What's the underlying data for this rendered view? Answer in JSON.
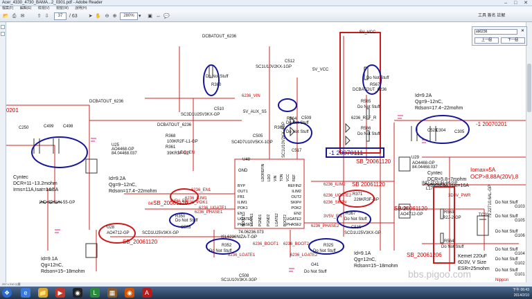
{
  "window": {
    "title": "Acer_4330_4730_BAMA...2_0301.pdf - Adobe Reader",
    "controls": "– □ ✕"
  },
  "menu": [
    "檔案(F)",
    "編輯(E)",
    "檢視(V)",
    "視窗(W)",
    "說明(H)"
  ],
  "toolbar": {
    "page_current": "37",
    "page_total": "/ 63",
    "zoom": "280%",
    "zoom_arrow": "▾",
    "page_label": "工具 簽名 註解"
  },
  "find": {
    "label": "搜尋",
    "value": "sb6236",
    "prev": "上一個",
    "next": "下一個",
    "close": "✕"
  },
  "status": {
    "text": "297 x 210 公厘"
  },
  "tray": {
    "time": "下午 06:43",
    "date": "2014/2/10"
  },
  "watermark": "bbs.pigoo.com",
  "colors": {
    "annot_red": "#cc1b1b",
    "annot_blue": "#16169a",
    "wire": "#cc2020",
    "pink": "#e0207a",
    "net": "#cc0000"
  },
  "schematic": {
    "chip": {
      "ref": "U48",
      "part": "74.06236.073",
      "name": "ISL6236NIZA-T-GP",
      "gnd": "GND"
    },
    "chip_pins_left": [
      "BYP",
      "OUT1",
      "FB1",
      "ILIM1",
      "POK1",
      "EN1",
      "UGATE1",
      "PHASE1"
    ],
    "chip_pins_right": [
      "REFIN2",
      "ILIM2",
      "OUT2",
      "SKIP#",
      "POK2",
      "EN2",
      "UGATE2",
      "PHASE2"
    ],
    "chip_pins_top": [
      "LDOREFIN",
      "LDO",
      "VIN",
      "TON",
      "VCC",
      "REF"
    ],
    "chip_pins_bottom": [
      "BOOT1",
      "LGATE1",
      "PGND1",
      "PGND2",
      "LGATE2",
      "BOOT2"
    ],
    "labels": [
      {
        "id": "dcbat1",
        "t": "DCBATOUT_6236"
      },
      {
        "id": "dcbat2",
        "t": "DCBATOUT_6236"
      },
      {
        "id": "dcbat3",
        "t": "DCBATOUT_6236"
      },
      {
        "id": "dcbat4",
        "t": "DCBATOUT_6236"
      },
      {
        "id": "r360",
        "t": "R360"
      },
      {
        "id": "dns1",
        "t": "Do Not Stuff"
      },
      {
        "id": "vin",
        "t": "6236_VIN"
      },
      {
        "id": "c512",
        "t": "C512"
      },
      {
        "id": "c512v",
        "t": "SC1U10V2KX-1GP"
      },
      {
        "id": "fivevcc1",
        "t": "5V_VCC"
      },
      {
        "id": "fivevcc2",
        "t": "5V_VCC"
      },
      {
        "id": "r567",
        "t": "R567"
      },
      {
        "id": "dns2",
        "t": "Do Not Stuff"
      },
      {
        "id": "r565",
        "t": "R565"
      },
      {
        "id": "dns3",
        "t": "Do Not Stuff"
      },
      {
        "id": "refr",
        "t": "6236_REF_R"
      },
      {
        "id": "r566",
        "t": "R566"
      },
      {
        "id": "dns4",
        "t": "Do Not Stuff"
      },
      {
        "id": "c510",
        "t": "C510"
      },
      {
        "id": "c510v",
        "t": "SC3D1U25V3KX-GP"
      },
      {
        "id": "auxs5",
        "t": "5V_AUX_S5"
      },
      {
        "id": "r364",
        "t": "R364"
      },
      {
        "id": "dns5",
        "t": "Do Not Stuff"
      },
      {
        "id": "r369",
        "t": "R369"
      },
      {
        "id": "dns6",
        "t": "Do Not Stuff"
      },
      {
        "id": "c509",
        "t": "C509"
      },
      {
        "id": "c505",
        "t": "C505"
      },
      {
        "id": "c505v",
        "t": "SC4D7U10V5KX-1GP"
      },
      {
        "id": "c517",
        "t": "C517"
      },
      {
        "id": "c517v",
        "t": "SC1U10V2KX-4GP"
      },
      {
        "id": "r368",
        "t": "R368"
      },
      {
        "id": "r368v",
        "t": "100KR2F-L1-GP"
      },
      {
        "id": "r361",
        "t": "R361"
      },
      {
        "id": "r361v",
        "t": "39KR3F-GP"
      },
      {
        "id": "ldoen",
        "t": "LDO_EN"
      },
      {
        "id": "u48",
        "t": "U48"
      },
      {
        "id": "sb1",
        "t": "SB_20061120"
      },
      {
        "id": "sb2",
        "t": "SB_20061120"
      },
      {
        "id": "sb3",
        "t": "SB_20061120"
      },
      {
        "id": "sb4",
        "t": "SB 20061120"
      },
      {
        "id": "sb5",
        "t": "SB_20061206"
      },
      {
        "id": "sb6",
        "t": "SB 20061120"
      },
      {
        "id": "rev1",
        "t": "-1 20070111"
      },
      {
        "id": "rev2",
        "t": "-1 20070201"
      },
      {
        "id": "rev3",
        "t": "0201"
      },
      {
        "id": "r371",
        "t": "R371"
      },
      {
        "id": "r371v",
        "t": "226KR3F-GP"
      },
      {
        "id": "r367",
        "t": "R367"
      },
      {
        "id": "dns7",
        "t": "Do Not Stuff"
      },
      {
        "id": "r350",
        "t": "R350"
      },
      {
        "id": "r350v",
        "t": "Do Not Stuff"
      },
      {
        "id": "r352",
        "t": "R352"
      },
      {
        "id": "dns8",
        "t": "Do Not Stuff"
      },
      {
        "id": "r325",
        "t": "R325"
      },
      {
        "id": "dns9",
        "t": "Do Not Stuff"
      },
      {
        "id": "c503",
        "t": "C503"
      },
      {
        "id": "c503v",
        "t": "SCD1U25V3KX-GP"
      },
      {
        "id": "c515",
        "t": "C515"
      },
      {
        "id": "c515v",
        "t": "SCD1U25V3KX-GP"
      },
      {
        "id": "c508",
        "t": "C508"
      },
      {
        "id": "c508v",
        "t": "SC1U10V3KX-3GP"
      },
      {
        "id": "g41",
        "t": "G41"
      },
      {
        "id": "dns10",
        "t": "Do Not Stuff"
      },
      {
        "id": "c499",
        "t": "C499"
      },
      {
        "id": "c498",
        "t": "C498"
      },
      {
        "id": "c250",
        "t": "C250"
      },
      {
        "id": "u25",
        "t": "U25"
      },
      {
        "id": "u25v",
        "t": "AO4468-GP"
      },
      {
        "id": "u25p",
        "t": "84.04468.037"
      },
      {
        "id": "u28",
        "t": "U28"
      },
      {
        "id": "u28v",
        "t": "AO4712-GP"
      },
      {
        "id": "u29",
        "t": "U29"
      },
      {
        "id": "u29v",
        "t": "AO4468-GP"
      },
      {
        "id": "u29p",
        "t": "84.04468.037"
      },
      {
        "id": "u30",
        "t": "U30"
      },
      {
        "id": "u30v",
        "t": "AO4712-GP"
      },
      {
        "id": "c523",
        "t": "C523"
      },
      {
        "id": "c304",
        "t": "C304"
      },
      {
        "id": "c305",
        "t": "C305"
      },
      {
        "id": "l16",
        "t": "L16"
      },
      {
        "id": "l16v",
        "t": "IND-3D3UH-55-GP"
      },
      {
        "id": "l17",
        "t": "L17"
      },
      {
        "id": "l17v",
        "t": "IND-2D2UH-44-GP"
      },
      {
        "id": "r563",
        "t": "R563"
      },
      {
        "id": "r563v",
        "t": "R2J-2-GP"
      },
      {
        "id": "r564",
        "t": "R564"
      },
      {
        "id": "dns11",
        "t": "Do Not Stuff"
      },
      {
        "id": "tc20",
        "t": "TC20"
      },
      {
        "id": "tc20v",
        "t": "79.22710.6AL-GP"
      },
      {
        "id": "nip",
        "t": "Nippon"
      },
      {
        "id": "pwr",
        "t": "3D3V_PWR"
      },
      {
        "id": "g103",
        "t": "G103"
      },
      {
        "id": "g105",
        "t": "G105"
      },
      {
        "id": "g106",
        "t": "G106"
      },
      {
        "id": "g104",
        "t": "G104"
      },
      {
        "id": "g102",
        "t": "G102"
      },
      {
        "id": "g101",
        "t": "G101"
      },
      {
        "id": "dnsg1",
        "t": "Do Not Stuff"
      },
      {
        "id": "dnsg2",
        "t": "Do Not Stuff"
      },
      {
        "id": "dnsg3",
        "t": "Do Not Stuff"
      },
      {
        "id": "dnsg4",
        "t": "Do Not Stuff"
      },
      {
        "id": "dnsg5",
        "t": "Do Not Stuff"
      },
      {
        "id": "dnsg6",
        "t": "Do Not Stuff"
      },
      {
        "id": "en1",
        "t": "6236_EN1"
      },
      {
        "id": "uph1",
        "t": "6236_UGATE1"
      },
      {
        "id": "ugt2",
        "t": "6236_UGATE2"
      },
      {
        "id": "ph2",
        "t": "6236_PHASE2"
      },
      {
        "id": "skip",
        "t": "6236_SKIP#"
      },
      {
        "id": "ilim2",
        "t": "6236_ILIM2"
      },
      {
        "id": "boot1",
        "t": "6236_BOOT1"
      },
      {
        "id": "lgt1",
        "t": "6236_LGATE1"
      },
      {
        "id": "boot2",
        "t": "6236_BOOT2"
      },
      {
        "id": "lgt2",
        "t": "6236_LGATE2"
      },
      {
        "id": "ilim1",
        "t": "6236_ILIM1"
      },
      {
        "id": "pok1",
        "t": "6236_POK1"
      },
      {
        "id": "ph1",
        "t": "6236_PHASE1"
      },
      {
        "id": "en5",
        "t": "3V5V_EN"
      },
      {
        "id": "en52",
        "t": "3V5V_EN"
      },
      {
        "id": "n104",
        "t": "04"
      }
    ],
    "notes": {
      "left": [
        "Cyntec",
        "DCR=11~13.2mohm",
        "Irms=11A,Isat=14.5A"
      ],
      "left_fet": [
        "Id=9.2A",
        "Qg=9~12nC,",
        "Rdson=17.4~22mohm"
      ],
      "left_low": [
        "Id=9.1A",
        "Qg=12nC,",
        "Rdson=15~18mohm"
      ],
      "right_fet": [
        "Id=9.2A",
        "Qg=9~12nC,",
        "Rdson=17.4~22mohm"
      ],
      "mid_low": [
        "Id=9.1A",
        "Qg=12nC,",
        "Rdson=15~18mohm"
      ],
      "right_cyn": [
        "Cyntec",
        "DCR=5.8~7mohm",
        "Irms=14A,Isat=16A"
      ],
      "iomax": [
        "Iomax=5A",
        "OCP>8.88A(20V),8"
      ],
      "kemet": [
        "Kemet 220uF",
        "6D3V, V Size",
        "ESR=25mohm"
      ]
    }
  }
}
